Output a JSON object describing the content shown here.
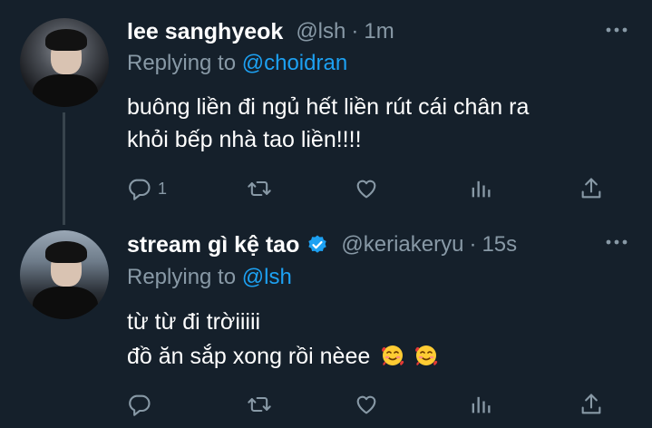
{
  "tweets": [
    {
      "name": "lee sanghyeok",
      "handle": "@lsh",
      "time": "1m",
      "replying_prefix": "Replying to",
      "replying_to": "@choidran",
      "text_lines": [
        "buông liền đi ngủ hết liền rút cái chân ra",
        "khỏi bếp nhà tao liền!!!!"
      ],
      "reply_count": "1",
      "verified": false
    },
    {
      "name": "stream gì kệ tao",
      "handle": "@keriakeryu",
      "time": "15s",
      "replying_prefix": "Replying to",
      "replying_to": "@lsh",
      "text_lines": [
        "từ từ đi trờiiiii",
        "đồ ăn sắp xong rồi nèee"
      ],
      "reply_count": "",
      "verified": true
    }
  ],
  "icons": [
    "reply-icon",
    "retweet-icon",
    "like-icon",
    "analytics-icon",
    "share-icon",
    "more-icon",
    "verified-icon",
    "smiling-face-with-hearts-icon"
  ],
  "colors": {
    "background": "#15202b",
    "text": "#ffffff",
    "secondary": "#8899a6",
    "accent": "#1da1f2",
    "thread_line": "#38444d"
  }
}
